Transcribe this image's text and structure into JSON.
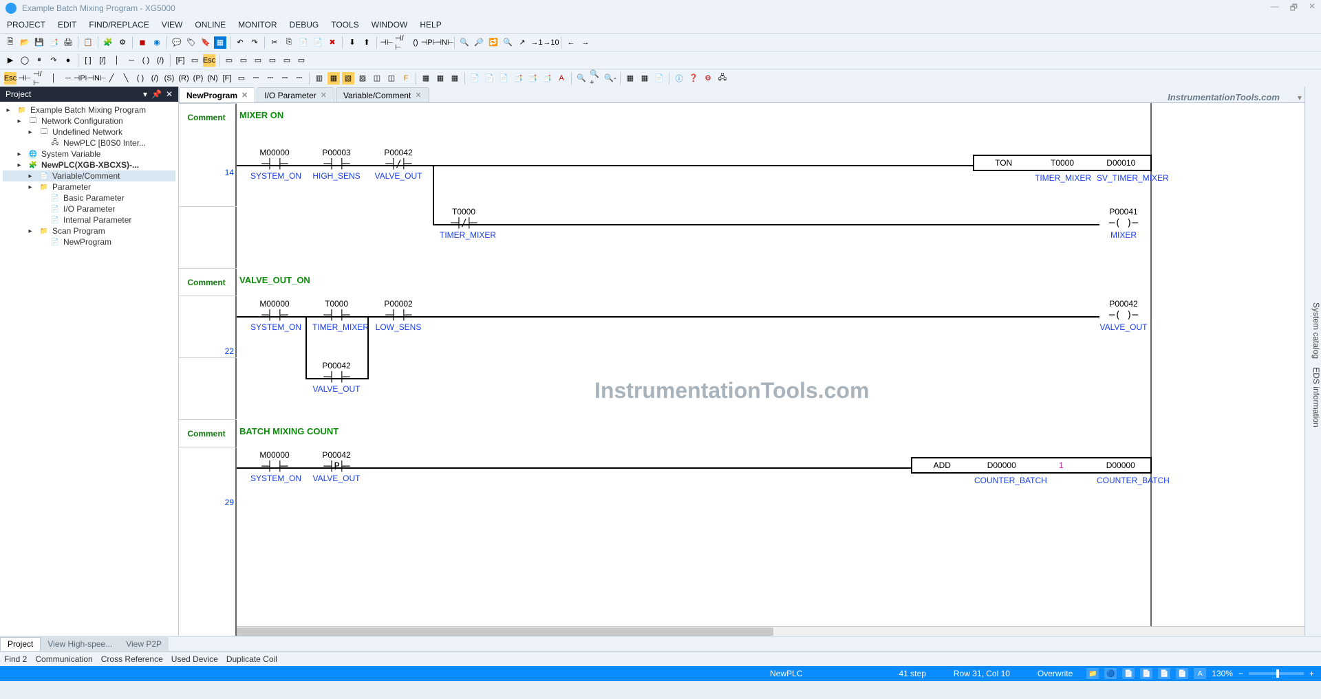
{
  "window": {
    "title": "Example  Batch Mixing Program - XG5000",
    "minimize": "—",
    "restore": "🗗",
    "close": "✕"
  },
  "menu": [
    "PROJECT",
    "EDIT",
    "FIND/REPLACE",
    "VIEW",
    "ONLINE",
    "MONITOR",
    "DEBUG",
    "TOOLS",
    "WINDOW",
    "HELP"
  ],
  "panels": {
    "project_header": "Project",
    "right_dock_1": "System catalog",
    "right_dock_2": "EDS information"
  },
  "tree": [
    {
      "level": 0,
      "icon": "📁",
      "label": "Example  Batch Mixing Program"
    },
    {
      "level": 1,
      "icon": "🗔",
      "label": "Network Configuration"
    },
    {
      "level": 2,
      "icon": "🗔",
      "label": "Undefined Network"
    },
    {
      "level": 3,
      "icon": "🖧",
      "label": "NewPLC [B0S0 Inter..."
    },
    {
      "level": 1,
      "icon": "🌐",
      "label": "System Variable"
    },
    {
      "level": 1,
      "icon": "🧩",
      "label": "NewPLC(XGB-XBCXS)-...",
      "bold": true
    },
    {
      "level": 2,
      "icon": "📄",
      "label": "Variable/Comment",
      "selected": true
    },
    {
      "level": 2,
      "icon": "📁",
      "label": "Parameter"
    },
    {
      "level": 3,
      "icon": "📄",
      "label": "Basic Parameter"
    },
    {
      "level": 3,
      "icon": "📄",
      "label": "I/O Parameter"
    },
    {
      "level": 3,
      "icon": "📄",
      "label": "Internal Parameter"
    },
    {
      "level": 2,
      "icon": "📁",
      "label": "Scan Program"
    },
    {
      "level": 3,
      "icon": "📄",
      "label": "NewProgram"
    }
  ],
  "tabs": [
    {
      "label": "NewProgram",
      "active": true
    },
    {
      "label": "I/O Parameter",
      "active": false
    },
    {
      "label": "Variable/Comment",
      "active": false
    }
  ],
  "tab_watermark": "InstrumentationTools.com",
  "ladder": {
    "comment_label": "Comment",
    "rung1": {
      "comment": "MIXER ON",
      "step": "14",
      "contacts": [
        {
          "addr": "M00000",
          "sym": "⊣ ⊢",
          "tag": "SYSTEM_ON"
        },
        {
          "addr": "P00003",
          "sym": "⊣ ⊢",
          "tag": "HIGH_SENS"
        },
        {
          "addr": "P00042",
          "sym": "⊣/⊢",
          "tag": "VALVE_OUT"
        }
      ],
      "func": {
        "name": "TON",
        "t": "T0000",
        "d": "D00010",
        "t_tag": "TIMER_MIXER",
        "d_tag": "SV_TIMER_MIXER"
      },
      "branch": {
        "addr": "T0000",
        "sym": "⊣/⊢",
        "tag": "TIMER_MIXER"
      },
      "coil": {
        "addr": "P00041",
        "sym": "( )",
        "tag": "MIXER"
      }
    },
    "rung2": {
      "comment": "VALVE_OUT_ON",
      "step": "22",
      "contacts": [
        {
          "addr": "M00000",
          "sym": "⊣ ⊢",
          "tag": "SYSTEM_ON"
        },
        {
          "addr": "T0000",
          "sym": "⊣ ⊢",
          "tag": "TIMER_MIXER"
        },
        {
          "addr": "P00002",
          "sym": "⊣ ⊢",
          "tag": "LOW_SENS"
        }
      ],
      "branch": {
        "addr": "P00042",
        "sym": "⊣ ⊢",
        "tag": "VALVE_OUT"
      },
      "coil": {
        "addr": "P00042",
        "sym": "( )",
        "tag": "VALVE_OUT"
      }
    },
    "rung3": {
      "comment": "BATCH MIXING COUNT",
      "step": "29",
      "contacts": [
        {
          "addr": "M00000",
          "sym": "⊣ ⊢",
          "tag": "SYSTEM_ON"
        },
        {
          "addr": "P00042",
          "sym": "⊣P⊢",
          "tag": "VALVE_OUT"
        }
      ],
      "func": {
        "name": "ADD",
        "a": "D00000",
        "b": "1",
        "c": "D00000",
        "a_tag": "COUNTER_BATCH",
        "c_tag": "COUNTER_BATCH"
      }
    },
    "big_watermark": "InstrumentationTools.com"
  },
  "bottom_tabs": [
    "Project",
    "View High-spee...",
    "View P2P"
  ],
  "output_tabs": [
    "Find 2",
    "Communication",
    "Cross Reference",
    "Used Device",
    "Duplicate Coil"
  ],
  "statusbar": {
    "plc": "NewPLC",
    "step": "41 step",
    "pos": "Row 31, Col 10",
    "mode": "Overwrite",
    "zoom": "130%"
  }
}
